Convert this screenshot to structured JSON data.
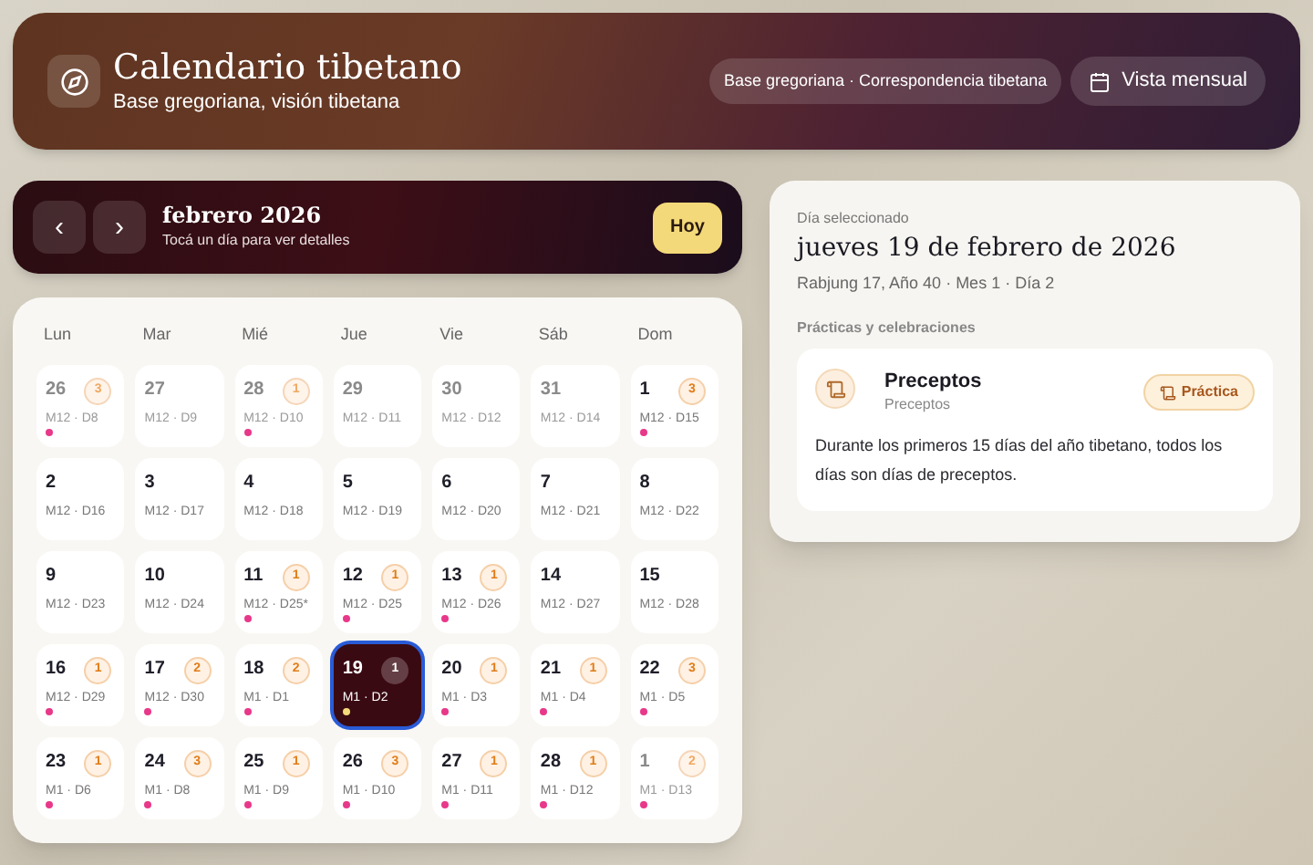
{
  "header": {
    "title": "Calendario tibetano",
    "subtitle": "Base gregoriana, visión tibetana",
    "chip": "Base gregoriana · Correspondencia tibetana",
    "view_button": "Vista mensual"
  },
  "month_bar": {
    "prev": "‹",
    "next": "›",
    "title": "febrero 2026",
    "hint": "Tocá un día para ver detalles",
    "today_button": "Hoy"
  },
  "weekdays": [
    "Lun",
    "Mar",
    "Mié",
    "Jue",
    "Vie",
    "Sáb",
    "Dom"
  ],
  "days": [
    {
      "day": "26",
      "lunar": "M12 · D8",
      "count": "3",
      "dot": true,
      "outside": true,
      "selected": false
    },
    {
      "day": "27",
      "lunar": "M12 · D9",
      "dot": false,
      "outside": true,
      "selected": false
    },
    {
      "day": "28",
      "lunar": "M12 · D10",
      "count": "1",
      "dot": true,
      "outside": true,
      "selected": false
    },
    {
      "day": "29",
      "lunar": "M12 · D11",
      "dot": false,
      "outside": true,
      "selected": false
    },
    {
      "day": "30",
      "lunar": "M12 · D12",
      "dot": false,
      "outside": true,
      "selected": false
    },
    {
      "day": "31",
      "lunar": "M12 · D14",
      "dot": false,
      "outside": true,
      "selected": false
    },
    {
      "day": "1",
      "lunar": "M12 · D15",
      "count": "3",
      "dot": true,
      "outside": false,
      "selected": false
    },
    {
      "day": "2",
      "lunar": "M12 · D16",
      "dot": false,
      "outside": false,
      "selected": false
    },
    {
      "day": "3",
      "lunar": "M12 · D17",
      "dot": false,
      "outside": false,
      "selected": false
    },
    {
      "day": "4",
      "lunar": "M12 · D18",
      "dot": false,
      "outside": false,
      "selected": false
    },
    {
      "day": "5",
      "lunar": "M12 · D19",
      "dot": false,
      "outside": false,
      "selected": false
    },
    {
      "day": "6",
      "lunar": "M12 · D20",
      "dot": false,
      "outside": false,
      "selected": false
    },
    {
      "day": "7",
      "lunar": "M12 · D21",
      "dot": false,
      "outside": false,
      "selected": false
    },
    {
      "day": "8",
      "lunar": "M12 · D22",
      "dot": false,
      "outside": false,
      "selected": false
    },
    {
      "day": "9",
      "lunar": "M12 · D23",
      "dot": false,
      "outside": false,
      "selected": false
    },
    {
      "day": "10",
      "lunar": "M12 · D24",
      "dot": false,
      "outside": false,
      "selected": false
    },
    {
      "day": "11",
      "lunar": "M12 · D25*",
      "count": "1",
      "dot": true,
      "outside": false,
      "selected": false
    },
    {
      "day": "12",
      "lunar": "M12 · D25",
      "count": "1",
      "dot": true,
      "outside": false,
      "selected": false
    },
    {
      "day": "13",
      "lunar": "M12 · D26",
      "count": "1",
      "dot": true,
      "outside": false,
      "selected": false
    },
    {
      "day": "14",
      "lunar": "M12 · D27",
      "dot": false,
      "outside": false,
      "selected": false
    },
    {
      "day": "15",
      "lunar": "M12 · D28",
      "dot": false,
      "outside": false,
      "selected": false
    },
    {
      "day": "16",
      "lunar": "M12 · D29",
      "count": "1",
      "dot": true,
      "outside": false,
      "selected": false
    },
    {
      "day": "17",
      "lunar": "M12 · D30",
      "count": "2",
      "dot": true,
      "outside": false,
      "selected": false
    },
    {
      "day": "18",
      "lunar": "M1 · D1",
      "count": "2",
      "dot": true,
      "outside": false,
      "selected": false
    },
    {
      "day": "19",
      "lunar": "M1 · D2",
      "count": "1",
      "dot": true,
      "outside": false,
      "selected": true
    },
    {
      "day": "20",
      "lunar": "M1 · D3",
      "count": "1",
      "dot": true,
      "outside": false,
      "selected": false
    },
    {
      "day": "21",
      "lunar": "M1 · D4",
      "count": "1",
      "dot": true,
      "outside": false,
      "selected": false
    },
    {
      "day": "22",
      "lunar": "M1 · D5",
      "count": "3",
      "dot": true,
      "outside": false,
      "selected": false
    },
    {
      "day": "23",
      "lunar": "M1 · D6",
      "count": "1",
      "dot": true,
      "outside": false,
      "selected": false
    },
    {
      "day": "24",
      "lunar": "M1 · D8",
      "count": "3",
      "dot": true,
      "outside": false,
      "selected": false
    },
    {
      "day": "25",
      "lunar": "M1 · D9",
      "count": "1",
      "dot": true,
      "outside": false,
      "selected": false
    },
    {
      "day": "26",
      "lunar": "M1 · D10",
      "count": "3",
      "dot": true,
      "outside": false,
      "selected": false
    },
    {
      "day": "27",
      "lunar": "M1 · D11",
      "count": "1",
      "dot": true,
      "outside": false,
      "selected": false
    },
    {
      "day": "28",
      "lunar": "M1 · D12",
      "count": "1",
      "dot": true,
      "outside": false,
      "selected": false
    },
    {
      "day": "1",
      "lunar": "M1 · D13",
      "count": "2",
      "dot": true,
      "outside": true,
      "selected": false
    }
  ],
  "detail": {
    "label": "Día seleccionado",
    "date": "jueves 19 de febrero de 2026",
    "tibetan": "Rabjung 17, Año 40 · Mes 1 · Día 2",
    "section": "Prácticas y celebraciones",
    "events": [
      {
        "title": "Preceptos",
        "subtitle": "Preceptos",
        "tag": "Práctica",
        "description": "Durante los primeros 15 días del año tibetano, todos los días son días de preceptos."
      }
    ]
  }
}
